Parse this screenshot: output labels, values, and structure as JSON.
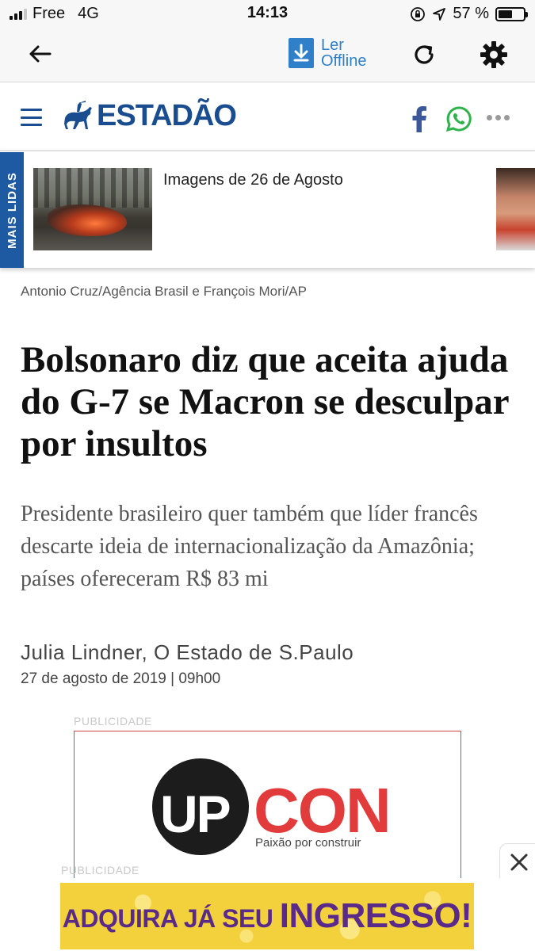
{
  "status_bar": {
    "carrier": "Free",
    "network": "4G",
    "time": "14:13",
    "battery": "57 %",
    "battery_level": 0.57
  },
  "toolbar": {
    "back_icon": "arrow-left-icon",
    "offline_label_line1": "Ler",
    "offline_label_line2": "Offline",
    "reload_icon": "reload-icon",
    "settings_icon": "gear-icon",
    "accent_color": "#2f7fc9"
  },
  "site_header": {
    "logo_text": "ESTADÃO",
    "brand_color": "#1a4d8f",
    "share_icons": [
      "facebook-icon",
      "whatsapp-icon",
      "more-icon"
    ]
  },
  "mais_lidas": {
    "label": "MAIS LIDAS",
    "story_title": "Imagens de 26 de Agosto"
  },
  "article": {
    "photo_credit": "Antonio Cruz/Agência Brasil e François Mori/AP",
    "headline": "Bolsonaro diz que aceita ajuda do G-7 se Macron se desculpar por insultos",
    "lede": "Presidente brasileiro quer também que líder francês descarte ideia de internacionalização da Amazônia; países ofereceram R$ 83 mi",
    "byline": "Julia Lindner, O Estado de S.Paulo",
    "date": "27 de agosto de 2019 | 09h00"
  },
  "ads": {
    "label_top": "PUBLICIDADE",
    "label_bottom": "PUBLICIDADE",
    "upcon_up": "UP",
    "upcon_con": "CON",
    "upcon_tagline": "Paixão por construir",
    "banner_text": "ADQUIRA JÁ SEU",
    "banner_emphasis": "INGRESSO!"
  }
}
